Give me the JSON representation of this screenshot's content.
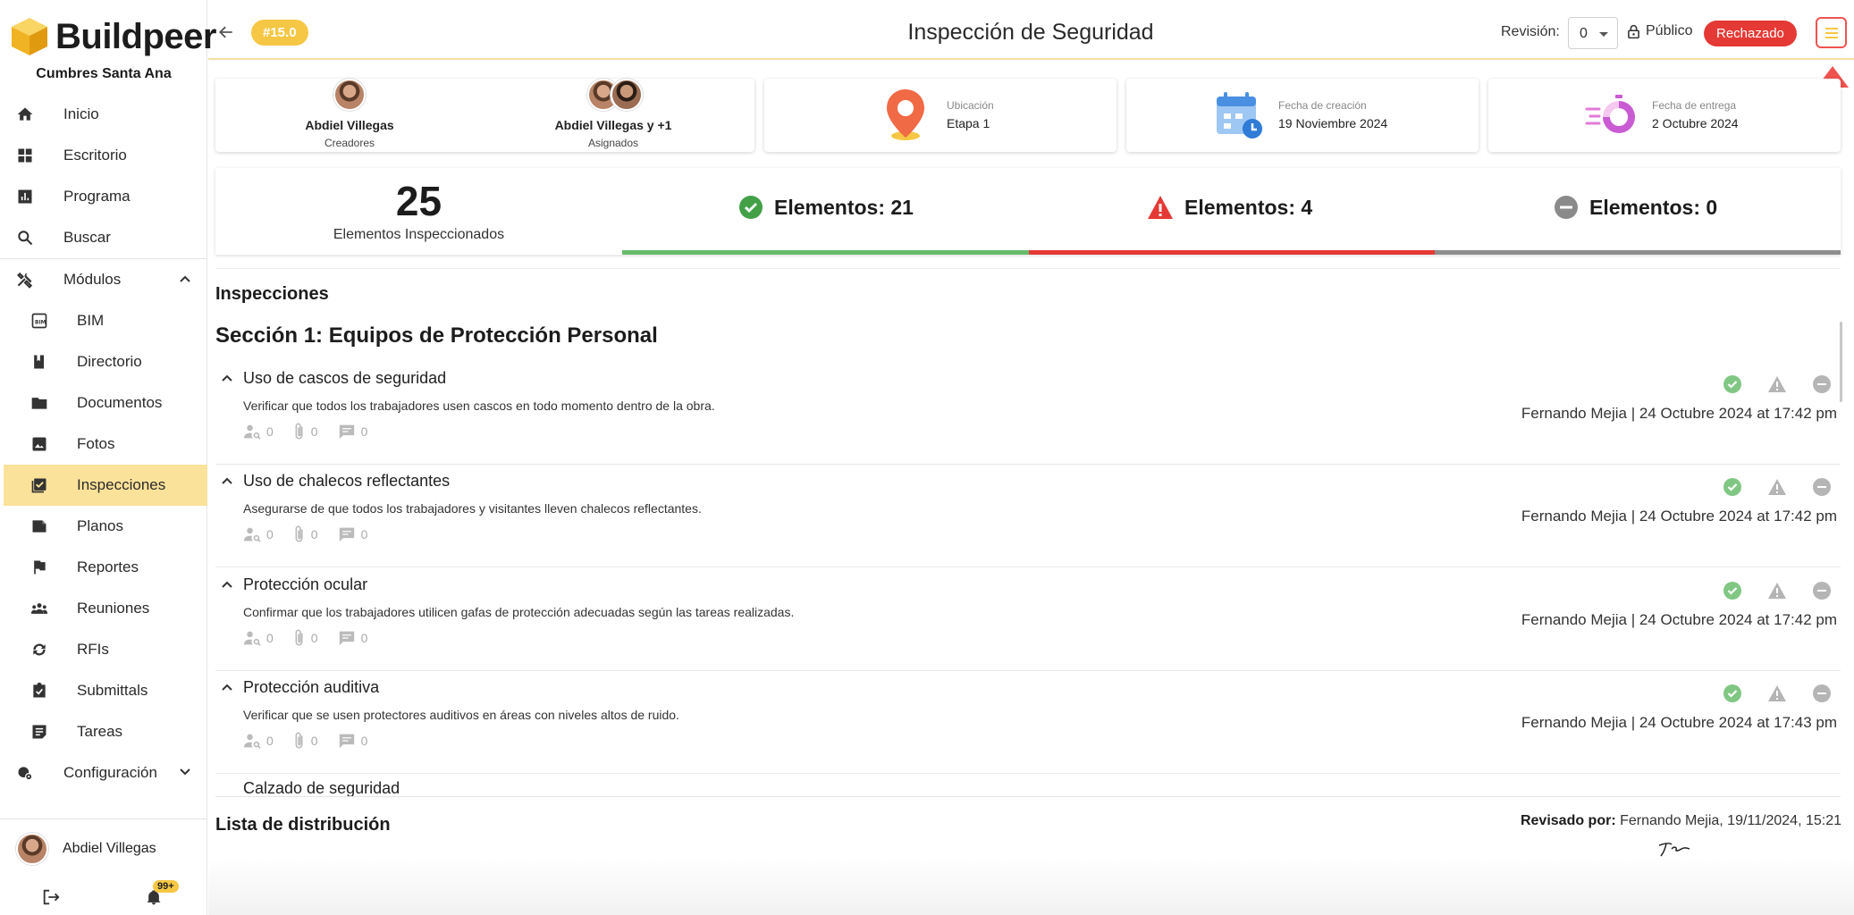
{
  "brand": {
    "name": "Buildpeer",
    "project": "Cumbres Santa Ana"
  },
  "sidebar": {
    "items": [
      {
        "label": "Inicio",
        "icon": "home-icon"
      },
      {
        "label": "Escritorio",
        "icon": "dashboard-icon"
      },
      {
        "label": "Programa",
        "icon": "chart-icon"
      },
      {
        "label": "Buscar",
        "icon": "search-icon"
      }
    ],
    "modules": {
      "label": "Módulos",
      "icon": "tools-icon"
    },
    "module_items": [
      {
        "label": "BIM",
        "icon": "bim-icon"
      },
      {
        "label": "Directorio",
        "icon": "book-icon"
      },
      {
        "label": "Documentos",
        "icon": "folder-icon"
      },
      {
        "label": "Fotos",
        "icon": "image-icon"
      },
      {
        "label": "Inspecciones",
        "icon": "checklist-icon",
        "active": true
      },
      {
        "label": "Planos",
        "icon": "plans-icon"
      },
      {
        "label": "Reportes",
        "icon": "flag-icon"
      },
      {
        "label": "Reuniones",
        "icon": "group-icon"
      },
      {
        "label": "RFIs",
        "icon": "sync-icon"
      },
      {
        "label": "Submittals",
        "icon": "assignment-icon"
      },
      {
        "label": "Tareas",
        "icon": "task-icon"
      }
    ],
    "config": {
      "label": "Configuración",
      "icon": "settings-icon"
    },
    "user": {
      "name": "Abdiel Villegas"
    },
    "notifications_badge": "99+"
  },
  "header": {
    "id_badge": "#15.0",
    "title": "Inspección de Seguridad",
    "revision_label": "Revisión:",
    "revision_value": "0",
    "visibility": "Público",
    "status": "Rechazado"
  },
  "info": {
    "creators": {
      "name": "Abdiel Villegas",
      "label": "Creadores"
    },
    "assignees": {
      "name": "Abdiel Villegas y +1",
      "label": "Asignados"
    },
    "location": {
      "label": "Ubicación",
      "value": "Etapa 1"
    },
    "created": {
      "label": "Fecha de creación",
      "value": "19 Noviembre 2024"
    },
    "due": {
      "label": "Fecha de entrega",
      "value": "2 Octubre 2024"
    }
  },
  "stats": {
    "total": "25",
    "total_label": "Elementos Inspeccionados",
    "ok": "Elementos: 21",
    "fail": "Elementos: 4",
    "na": "Elementos: 0"
  },
  "colors": {
    "ok": "#43a047",
    "fail": "#e53935",
    "na": "#8a8a8a",
    "accent": "#f6c744",
    "active_bg": "#fbe29a"
  },
  "inspections": {
    "heading": "Inspecciones",
    "section_title": "Sección 1: Equipos de Protección Personal",
    "items": [
      {
        "title": "Uso de cascos de seguridad",
        "desc": "Verificar que todos los trabajadores usen cascos en todo momento dentro de la obra.",
        "assignees": "0",
        "attachments": "0",
        "comments": "0",
        "signed": "Fernando Mejia | 24 Octubre 2024 at 17:42 pm"
      },
      {
        "title": "Uso de chalecos reflectantes",
        "desc": "Asegurarse de que todos los trabajadores y visitantes lleven chalecos reflectantes.",
        "assignees": "0",
        "attachments": "0",
        "comments": "0",
        "signed": "Fernando Mejia | 24 Octubre 2024 at 17:42 pm"
      },
      {
        "title": "Protección ocular",
        "desc": "Confirmar que los trabajadores utilicen gafas de protección adecuadas según las tareas realizadas.",
        "assignees": "0",
        "attachments": "0",
        "comments": "0",
        "signed": "Fernando Mejia | 24 Octubre 2024 at 17:42 pm"
      },
      {
        "title": "Protección auditiva",
        "desc": "Verificar que se usen protectores auditivos en áreas con niveles altos de ruido.",
        "assignees": "0",
        "attachments": "0",
        "comments": "0",
        "signed": "Fernando Mejia | 24 Octubre 2024 at 17:43 pm"
      }
    ],
    "cut_item_title": "Calzado de seguridad"
  },
  "distribution": {
    "heading": "Lista de distribución",
    "reviewed_label": "Revisado por:",
    "reviewed_value": "Fernando Mejia, 19/11/2024, 15:21"
  }
}
